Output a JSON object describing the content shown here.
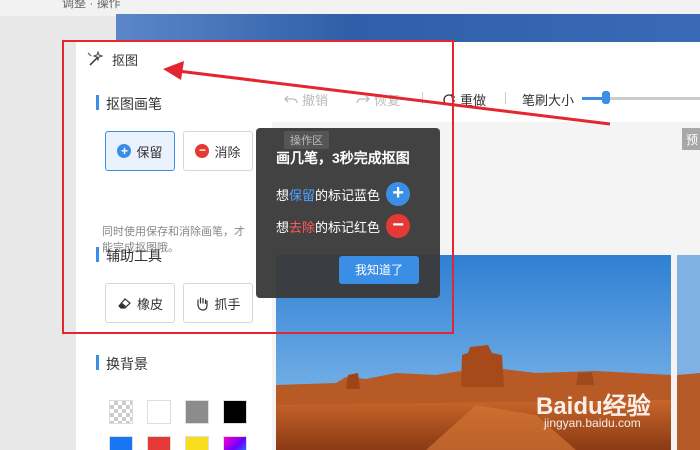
{
  "page": {
    "top_text": "调整 · 操作"
  },
  "window": {
    "title": "抠图",
    "title_icon": "magic-wand-icon"
  },
  "sidebar": {
    "section_brush": "抠图画笔",
    "keep_label": "保留",
    "erase_label": "消除",
    "hint": "同时使用保存和消除画笔，才能完成抠图哦。",
    "section_tools": "辅助工具",
    "eraser_label": "橡皮",
    "hand_label": "抓手",
    "section_bg": "换背景",
    "swatches": [
      "transparent",
      "#ffffff",
      "#8c8c8c",
      "#000000",
      "#1976f2",
      "#e53935",
      "#f9dd1f",
      "gradient"
    ]
  },
  "toolbar": {
    "undo_label": "撤销",
    "redo_label": "恢复",
    "reset_label": "重做",
    "brush_size_label": "笔刷大小",
    "brush_size": 0.2
  },
  "canvas": {
    "zone_label": "操作区",
    "preview_label": "预"
  },
  "tip": {
    "title": "画几笔，3秒完成抠图",
    "line1_prefix": "想",
    "line1_keyword": "保留",
    "line1_suffix": "的标记蓝色",
    "line2_prefix": "想",
    "line2_keyword": "去除",
    "line2_suffix": "的标记红色",
    "button_label": "我知道了"
  },
  "colors": {
    "accent": "#3a8ee6",
    "highlight_box": "#e3262f",
    "erase_red": "#e53935"
  },
  "watermark": {
    "brand": "Baidu经验",
    "site": "jingyan.baidu.com"
  }
}
